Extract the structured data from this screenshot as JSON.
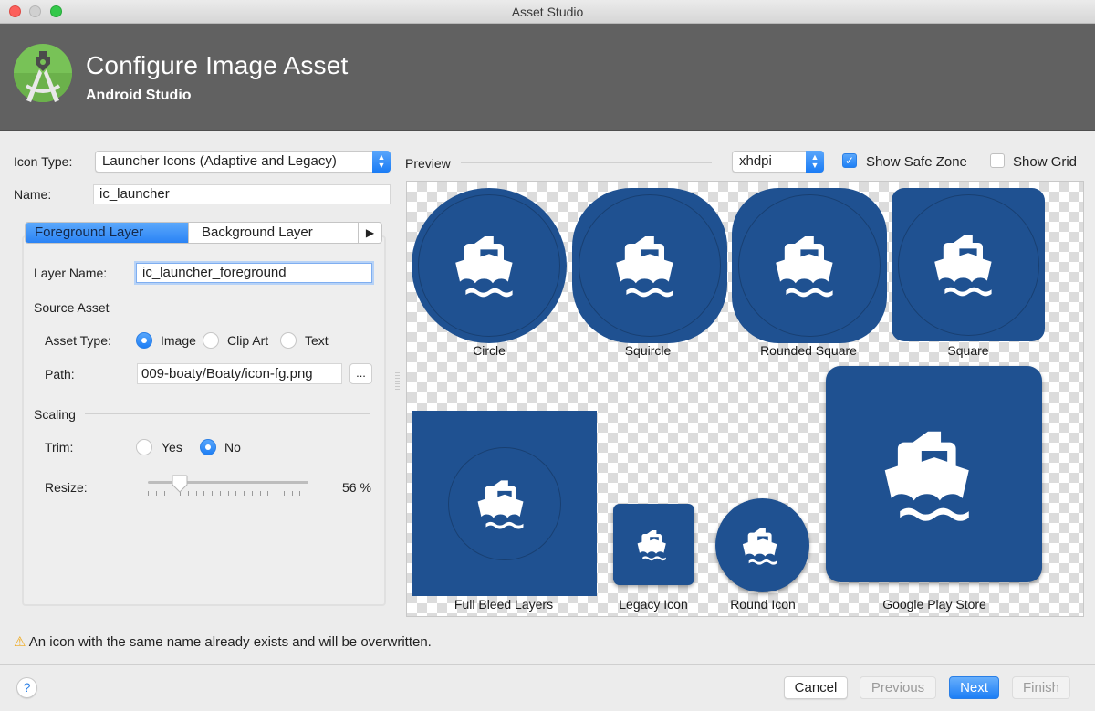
{
  "window": {
    "title": "Asset Studio"
  },
  "header": {
    "title": "Configure Image Asset",
    "subtitle": "Android Studio"
  },
  "form": {
    "icon_type_label": "Icon Type:",
    "icon_type_value": "Launcher Icons (Adaptive and Legacy)",
    "name_label": "Name:",
    "name_value": "ic_launcher"
  },
  "tabs": [
    {
      "label": "Foreground Layer",
      "active": true
    },
    {
      "label": "Background Layer",
      "active": false
    },
    {
      "label": "▶",
      "active": false
    }
  ],
  "layer": {
    "layer_name_label": "Layer Name:",
    "layer_name_value": "ic_launcher_foreground",
    "source_asset_heading": "Source Asset",
    "asset_type_label": "Asset Type:",
    "asset_type_options": [
      {
        "label": "Image",
        "selected": true
      },
      {
        "label": "Clip Art",
        "selected": false
      },
      {
        "label": "Text",
        "selected": false
      }
    ],
    "path_label": "Path:",
    "path_value": "009-boaty/Boaty/icon-fg.png",
    "browse_label": "...",
    "scaling_heading": "Scaling",
    "trim_label": "Trim:",
    "trim_options": [
      {
        "label": "Yes",
        "selected": false
      },
      {
        "label": "No",
        "selected": true
      }
    ],
    "resize_label": "Resize:",
    "resize_value_percent": 56,
    "resize_text": "56 %"
  },
  "preview": {
    "label": "Preview",
    "density_value": "xhdpi",
    "show_safe_zone_label": "Show Safe Zone",
    "show_safe_zone_checked": true,
    "show_grid_label": "Show Grid",
    "show_grid_checked": false,
    "icon_color": "#1f5191",
    "icons": [
      {
        "caption": "Circle"
      },
      {
        "caption": "Squircle"
      },
      {
        "caption": "Rounded Square"
      },
      {
        "caption": "Square"
      },
      {
        "caption": "Full Bleed Layers"
      },
      {
        "caption": "Legacy Icon"
      },
      {
        "caption": "Round Icon"
      },
      {
        "caption": "Google Play Store"
      }
    ]
  },
  "warning": {
    "icon": "warning-icon",
    "text": "An icon with the same name already exists and will be overwritten."
  },
  "footer": {
    "help_label": "?",
    "cancel_label": "Cancel",
    "previous_label": "Previous",
    "next_label": "Next",
    "finish_label": "Finish"
  },
  "colors": {
    "accent": "#1c7ef5",
    "header_bg": "#616161",
    "icon_bg": "#1f5191"
  }
}
